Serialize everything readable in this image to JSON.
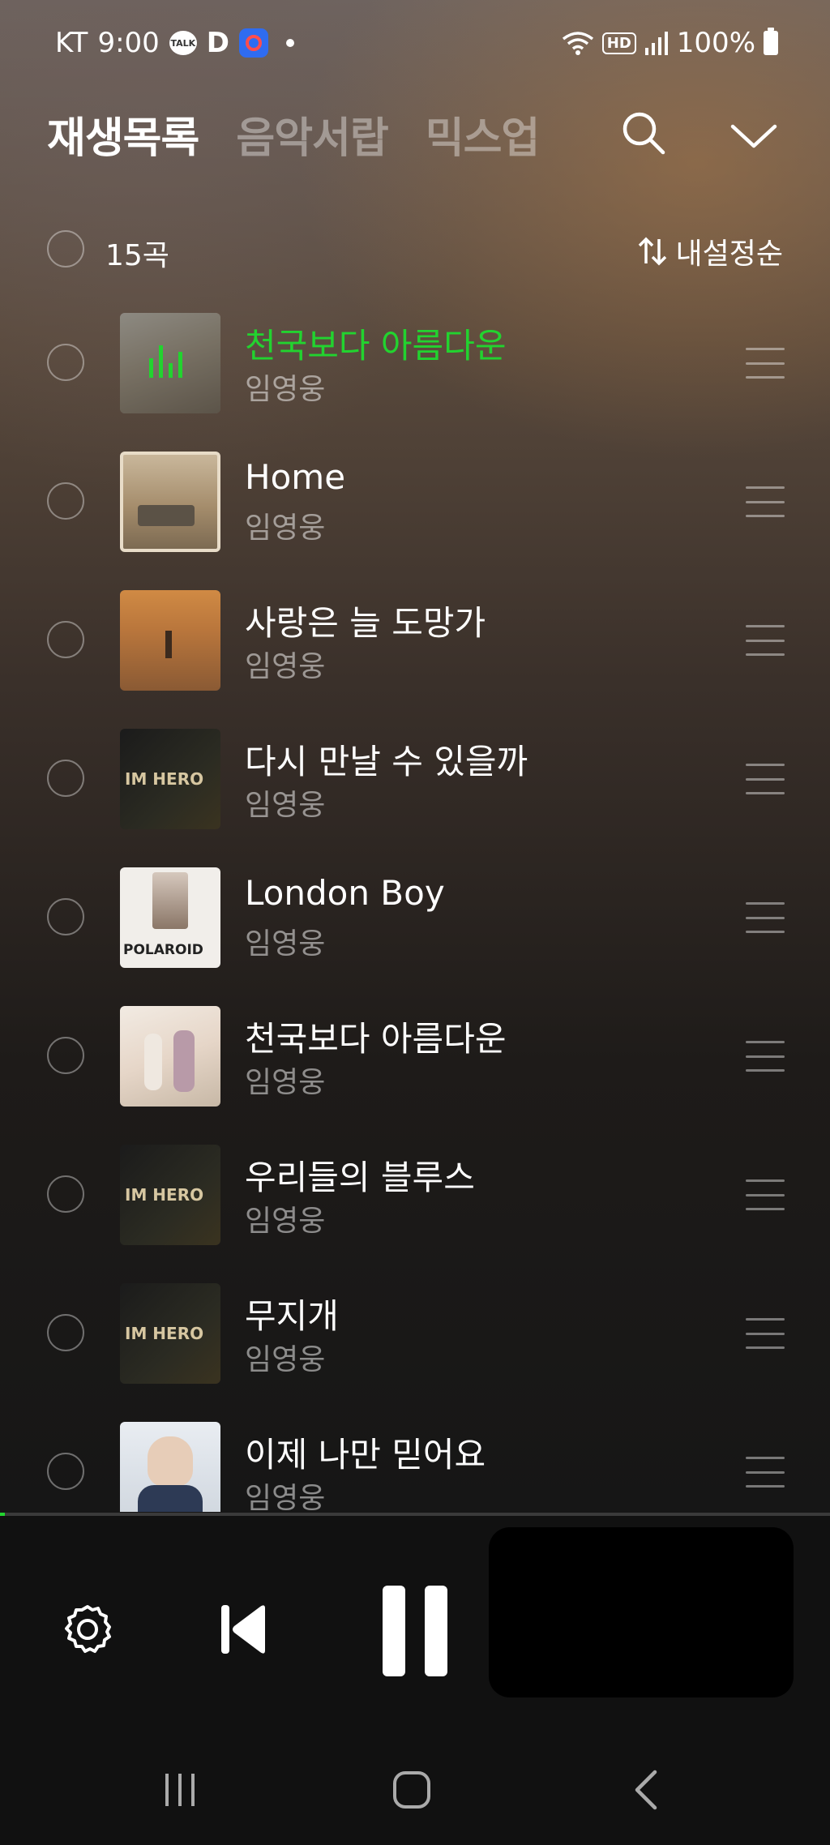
{
  "status_bar": {
    "carrier": "KT",
    "time": "9:00",
    "talk_icon_label": "TALK",
    "d_icon_label": "D",
    "hd_label": "HD",
    "battery": "100%"
  },
  "tabs": [
    {
      "label": "재생목록",
      "active": true
    },
    {
      "label": "음악서랍",
      "active": false
    },
    {
      "label": "믹스업",
      "active": false
    }
  ],
  "list_header": {
    "count": "15곡",
    "sort_label": "내설정순"
  },
  "tracks": [
    {
      "title": "천국보다 아름다운",
      "artist": "임영웅",
      "playing": true
    },
    {
      "title": "Home",
      "artist": "임영웅",
      "playing": false
    },
    {
      "title": "사랑은 늘 도망가",
      "artist": "임영웅",
      "playing": false
    },
    {
      "title": "다시 만날 수 있을까",
      "artist": "임영웅",
      "playing": false
    },
    {
      "title": "London Boy",
      "artist": "임영웅",
      "playing": false
    },
    {
      "title": "천국보다 아름다운",
      "artist": "임영웅",
      "playing": false
    },
    {
      "title": "우리들의 블루스",
      "artist": "임영웅",
      "playing": false
    },
    {
      "title": "무지개",
      "artist": "임영웅",
      "playing": false
    },
    {
      "title": "이제 나만 믿어요",
      "artist": "임영웅",
      "playing": false
    }
  ],
  "album_art_text": {
    "im_hero": "IM HERO",
    "polaroid": "POLAROID"
  },
  "player": {
    "progress_fraction": 0.006,
    "accent": "#22d32f"
  },
  "icons": [
    "search-icon",
    "chevron-down-icon",
    "sort-icon",
    "drag-handle-icon",
    "settings-icon",
    "previous-icon",
    "pause-icon",
    "recents-icon",
    "home-icon",
    "back-icon"
  ]
}
